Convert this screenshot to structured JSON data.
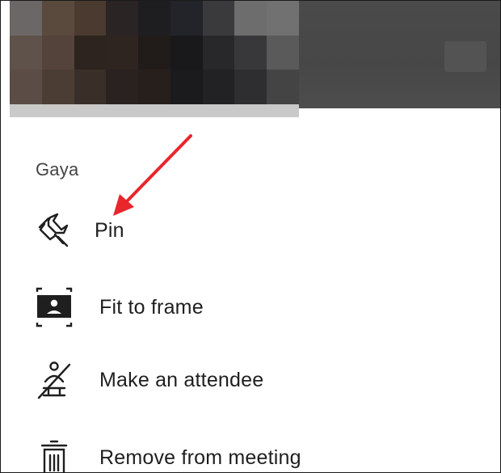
{
  "participant": {
    "name": "Gaya"
  },
  "menu": {
    "items": [
      {
        "label": "Pin",
        "icon": "pin-icon"
      },
      {
        "label": "Fit to frame",
        "icon": "fit-to-frame-icon"
      },
      {
        "label": "Make an attendee",
        "icon": "make-attendee-icon"
      },
      {
        "label": "Remove from meeting",
        "icon": "trash-icon"
      }
    ]
  },
  "colors": {
    "annotation_arrow": "#e8262b",
    "text": "#1f1f1f",
    "name_text": "#444444"
  },
  "video": {
    "pixelated_tiles": [
      "#6b6766",
      "#5a4a3d",
      "#4a3a30",
      "#2a2424",
      "#1e1e21",
      "#23232a",
      "#3a3a3c",
      "#6d6d6d",
      "#717171",
      "#5f524a",
      "#54433a",
      "#2d241f",
      "#2e2420",
      "#211b1a",
      "#19191b",
      "#28282a",
      "#38383a",
      "#5a5a5a",
      "#5b4d45",
      "#4b3d33",
      "#3a2e28",
      "#2a2220",
      "#261f1c",
      "#1b1b1d",
      "#222224",
      "#2e2e30",
      "#444444"
    ]
  }
}
